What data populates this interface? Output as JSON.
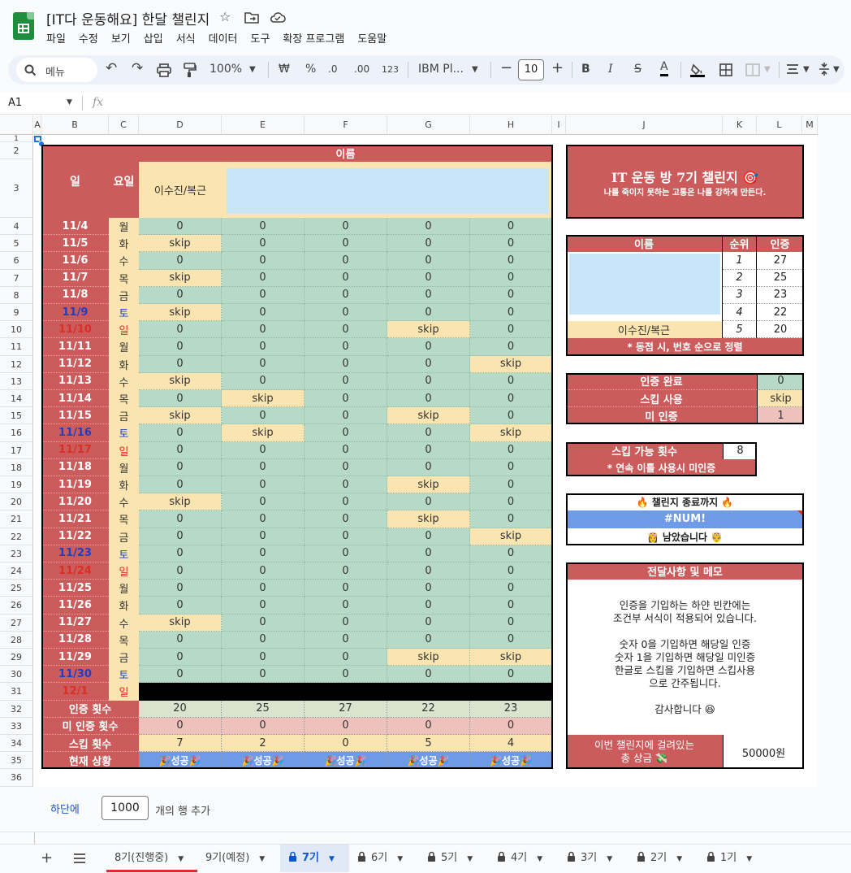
{
  "app": {
    "title": "[IT다 운동해요] 한달 챌린지",
    "menu": [
      "파일",
      "수정",
      "보기",
      "삽입",
      "서식",
      "데이터",
      "도구",
      "확장 프로그램",
      "도움말"
    ]
  },
  "toolbar": {
    "search": "메뉴",
    "zoom": "100%",
    "currency": "₩",
    "percent": "%",
    "dec_less": ".0",
    "dec_more": ".00",
    "format_123": "123",
    "font": "IBM Pl...",
    "font_size": "10",
    "bold": "B",
    "italic": "I",
    "strike": "S",
    "text_color": "A"
  },
  "formula_bar": {
    "cell_ref": "A1",
    "fx": "fx"
  },
  "columns": [
    "A",
    "B",
    "C",
    "D",
    "E",
    "F",
    "G",
    "H",
    "I",
    "J",
    "K",
    "L",
    "M"
  ],
  "rows": [
    "1",
    "2",
    "3",
    "4",
    "5",
    "6",
    "7",
    "8",
    "9",
    "10",
    "11",
    "12",
    "13",
    "14",
    "15",
    "16",
    "17",
    "18",
    "19",
    "20",
    "21",
    "22",
    "23",
    "24",
    "25",
    "26",
    "27",
    "28",
    "29",
    "30",
    "31",
    "32",
    "33",
    "34",
    "35",
    "36"
  ],
  "sheet": {
    "header_day": "일",
    "header_weekday": "요일",
    "header_name": "이름",
    "member_name": "이수진/복근",
    "days": [
      {
        "date": "11/4",
        "wd": "월",
        "vals": [
          "0",
          "0",
          "0",
          "0",
          "0"
        ]
      },
      {
        "date": "11/5",
        "wd": "화",
        "vals": [
          "skip",
          "0",
          "0",
          "0",
          "0"
        ]
      },
      {
        "date": "11/6",
        "wd": "수",
        "vals": [
          "0",
          "0",
          "0",
          "0",
          "0"
        ]
      },
      {
        "date": "11/7",
        "wd": "목",
        "vals": [
          "skip",
          "0",
          "0",
          "0",
          "0"
        ]
      },
      {
        "date": "11/8",
        "wd": "금",
        "vals": [
          "0",
          "0",
          "0",
          "0",
          "0"
        ]
      },
      {
        "date": "11/9",
        "wd": "토",
        "vals": [
          "skip",
          "0",
          "0",
          "0",
          "0"
        ]
      },
      {
        "date": "11/10",
        "wd": "일",
        "vals": [
          "0",
          "0",
          "0",
          "skip",
          "0"
        ]
      },
      {
        "date": "11/11",
        "wd": "월",
        "vals": [
          "0",
          "0",
          "0",
          "0",
          "0"
        ]
      },
      {
        "date": "11/12",
        "wd": "화",
        "vals": [
          "0",
          "0",
          "0",
          "0",
          "skip"
        ]
      },
      {
        "date": "11/13",
        "wd": "수",
        "vals": [
          "skip",
          "0",
          "0",
          "0",
          "0"
        ]
      },
      {
        "date": "11/14",
        "wd": "목",
        "vals": [
          "0",
          "skip",
          "0",
          "0",
          "0"
        ]
      },
      {
        "date": "11/15",
        "wd": "금",
        "vals": [
          "skip",
          "0",
          "0",
          "skip",
          "0"
        ]
      },
      {
        "date": "11/16",
        "wd": "토",
        "vals": [
          "0",
          "skip",
          "0",
          "0",
          "skip"
        ]
      },
      {
        "date": "11/17",
        "wd": "일",
        "vals": [
          "0",
          "0",
          "0",
          "0",
          "0"
        ]
      },
      {
        "date": "11/18",
        "wd": "월",
        "vals": [
          "0",
          "0",
          "0",
          "0",
          "0"
        ]
      },
      {
        "date": "11/19",
        "wd": "화",
        "vals": [
          "0",
          "0",
          "0",
          "skip",
          "0"
        ]
      },
      {
        "date": "11/20",
        "wd": "수",
        "vals": [
          "skip",
          "0",
          "0",
          "0",
          "0"
        ]
      },
      {
        "date": "11/21",
        "wd": "목",
        "vals": [
          "0",
          "0",
          "0",
          "skip",
          "0"
        ]
      },
      {
        "date": "11/22",
        "wd": "금",
        "vals": [
          "0",
          "0",
          "0",
          "0",
          "skip"
        ]
      },
      {
        "date": "11/23",
        "wd": "토",
        "vals": [
          "0",
          "0",
          "0",
          "0",
          "0"
        ]
      },
      {
        "date": "11/24",
        "wd": "일",
        "vals": [
          "0",
          "0",
          "0",
          "0",
          "0"
        ]
      },
      {
        "date": "11/25",
        "wd": "월",
        "vals": [
          "0",
          "0",
          "0",
          "0",
          "0"
        ]
      },
      {
        "date": "11/26",
        "wd": "화",
        "vals": [
          "0",
          "0",
          "0",
          "0",
          "0"
        ]
      },
      {
        "date": "11/27",
        "wd": "수",
        "vals": [
          "skip",
          "0",
          "0",
          "0",
          "0"
        ]
      },
      {
        "date": "11/28",
        "wd": "목",
        "vals": [
          "0",
          "0",
          "0",
          "0",
          "0"
        ]
      },
      {
        "date": "11/29",
        "wd": "금",
        "vals": [
          "0",
          "0",
          "0",
          "skip",
          "skip"
        ]
      },
      {
        "date": "11/30",
        "wd": "토",
        "vals": [
          "0",
          "0",
          "0",
          "0",
          "0"
        ]
      },
      {
        "date": "12/1",
        "wd": "일",
        "vals": []
      }
    ],
    "summary": {
      "cert_label": "인증 횟수",
      "cert": [
        "20",
        "25",
        "27",
        "22",
        "23"
      ],
      "uncert_label": "미 인증 횟수",
      "uncert": [
        "0",
        "0",
        "0",
        "0",
        "0"
      ],
      "skip_label": "스킵 횟수",
      "skip": [
        "7",
        "2",
        "0",
        "5",
        "4"
      ],
      "status_label": "현재 상황",
      "status": [
        "🎉성공🎉",
        "🎉성공🎉",
        "🎉성공🎉",
        "🎉성공🎉",
        "🎉성공🎉"
      ]
    },
    "colors": {
      "red": "#cc5c5c",
      "green": "#b7dac7",
      "yellow": "#fae4b0",
      "pink": "#efc1bd",
      "blue": "#6f9be6",
      "sat": "#1c3fc7",
      "sun": "#d93025"
    }
  },
  "panel": {
    "title": "IT 운동 방 7기 챌린지 🎯",
    "subtitle": "나를 죽이지 못하는 고통은 나를 강하게 만든다.",
    "rank_headers": [
      "이름",
      "순위",
      "인증"
    ],
    "ranks": [
      {
        "rank": "1",
        "score": "27"
      },
      {
        "rank": "2",
        "score": "25"
      },
      {
        "rank": "3",
        "score": "23"
      },
      {
        "rank": "4",
        "score": "22"
      },
      {
        "rank": "5",
        "score": "20",
        "name": "이수진/복근"
      }
    ],
    "rank_note": "* 동점 시, 번호 순으로 정렬",
    "legend": [
      {
        "label": "인증 완료",
        "value": "0"
      },
      {
        "label": "스킵 사용",
        "value": "skip"
      },
      {
        "label": "미 인증",
        "value": "1"
      }
    ],
    "skip_allowed_label": "스킵 가능 횟수",
    "skip_allowed": "8",
    "skip_note": "* 연속 이틀 사용시 미인증",
    "countdown_title": "🔥 챌린지 종료까지 🔥",
    "countdown_value": "#NUM!",
    "countdown_suffix": "👸 남았습니다 🤴",
    "memo_title": "전달사항 및 메모",
    "memo_lines": [
      "인증을 기입하는 하얀 빈칸에는",
      "조건부 서식이 적용되어 있습니다.",
      "",
      "숫자 0을 기입하면 해당일 인증",
      "숫자 1을 기입하면 해당일 미인증",
      "한글로 스킵을 기입하면 스킵사용",
      "으로 간주됩니다.",
      "",
      "감사합니다 😆"
    ],
    "prize_label": "이번 챌린지에 걸려있는\n총 상금 💸",
    "prize_value": "50000원"
  },
  "add_rows": {
    "link": "하단에",
    "count": "1000",
    "suffix": "개의 행 추가"
  },
  "tabs": [
    {
      "label": "8기(진행중)",
      "active": false,
      "locked": false
    },
    {
      "label": "9기(예정)",
      "active": false,
      "locked": false
    },
    {
      "label": "7기",
      "active": true,
      "locked": true
    },
    {
      "label": "6기",
      "active": false,
      "locked": true
    },
    {
      "label": "5기",
      "active": false,
      "locked": true
    },
    {
      "label": "4기",
      "active": false,
      "locked": true
    },
    {
      "label": "3기",
      "active": false,
      "locked": true
    },
    {
      "label": "2기",
      "active": false,
      "locked": true
    },
    {
      "label": "1기",
      "active": false,
      "locked": true
    }
  ]
}
